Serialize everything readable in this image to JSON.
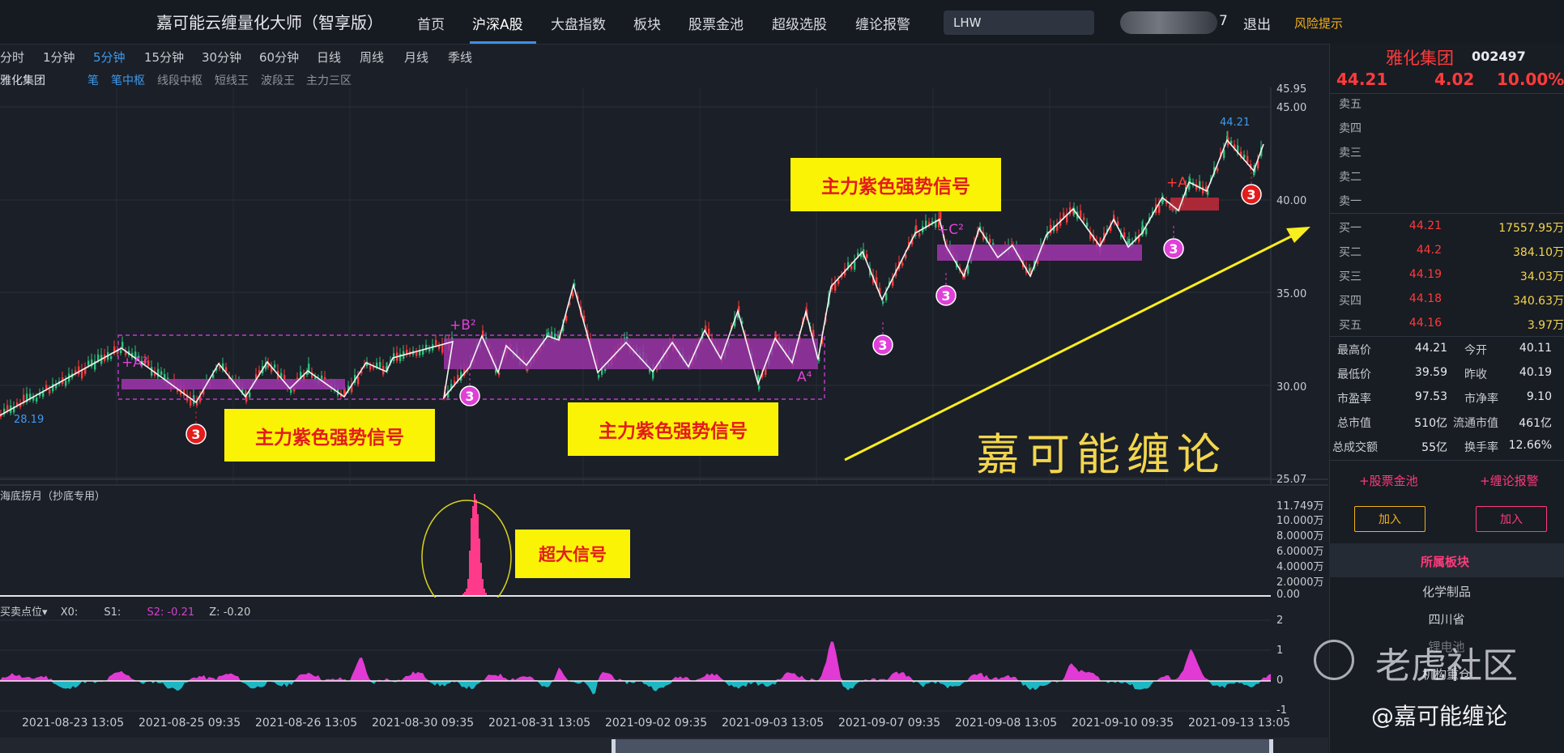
{
  "app": {
    "title": "嘉可能云缠量化大师（智享版）"
  },
  "nav": {
    "items": [
      "首页",
      "沪深A股",
      "大盘指数",
      "板块",
      "股票金池",
      "超级选股",
      "缠论报警"
    ],
    "active": "沪深A股"
  },
  "search": {
    "value": "LHW"
  },
  "user": {
    "suffix": "7",
    "logout": "退出",
    "risk": "风险提示"
  },
  "periods": {
    "items": [
      "分时",
      "1分钟",
      "5分钟",
      "15分钟",
      "30分钟",
      "60分钟",
      "日线",
      "周线",
      "月线",
      "季线"
    ],
    "active": "5分钟"
  },
  "indicator_bar": {
    "stock": "雅化集团",
    "items": [
      "笔",
      "笔中枢",
      "线段中枢",
      "短线王",
      "波段王",
      "主力三区"
    ],
    "active": [
      "笔",
      "笔中枢"
    ]
  },
  "price_axis": {
    "labels": [
      "45.95",
      "45.00",
      "40.00",
      "35.00",
      "30.00",
      "25.07"
    ]
  },
  "price_markers": {
    "last": "44.21",
    "low": "28.19"
  },
  "annotations": {
    "signal_text": "主力紫色强势信号",
    "big_signal": "超大信号",
    "brand": "嘉可能缠论",
    "labels": [
      "+A²",
      "+B²",
      "A⁴",
      "+C²",
      "+A"
    ],
    "badge": "3"
  },
  "sub_panel": {
    "title": "海底捞月（抄底专用）",
    "axis": [
      "11.749万",
      "10.000万",
      "8.0000万",
      "6.0000万",
      "4.0000万",
      "2.0000万",
      "0.00"
    ]
  },
  "osc_panel": {
    "name": "买卖点位",
    "x0": "X0:",
    "s1": "S1:",
    "s2_label": "S2:",
    "s2": "-0.21",
    "z_label": "Z:",
    "z": "-0.20",
    "axis": [
      "2",
      "1",
      "0",
      "-1"
    ]
  },
  "dates": [
    "2021-08-23 13:05",
    "2021-08-25 09:35",
    "2021-08-26 13:05",
    "2021-08-30 09:35",
    "2021-08-31 13:05",
    "2021-09-02 09:35",
    "2021-09-03 13:05",
    "2021-09-07 09:35",
    "2021-09-08 13:05",
    "2021-09-10 09:35",
    "2021-09-13 13:05"
  ],
  "stock": {
    "name": "雅化集团",
    "code": "002497",
    "price": "44.21",
    "change": "4.02",
    "pct": "10.00%"
  },
  "order_book": {
    "asks": [
      {
        "label": "卖五"
      },
      {
        "label": "卖四"
      },
      {
        "label": "卖三"
      },
      {
        "label": "卖二"
      },
      {
        "label": "卖一"
      }
    ],
    "bids": [
      {
        "label": "买一",
        "price": "44.21",
        "vol": "17557.95万"
      },
      {
        "label": "买二",
        "price": "44.2",
        "vol": "384.10万"
      },
      {
        "label": "买三",
        "price": "44.19",
        "vol": "34.03万"
      },
      {
        "label": "买四",
        "price": "44.18",
        "vol": "340.63万"
      },
      {
        "label": "买五",
        "price": "44.16",
        "vol": "3.97万"
      }
    ]
  },
  "stats": [
    {
      "l1": "最高价",
      "v1": "44.21",
      "l2": "今开",
      "v2": "40.11"
    },
    {
      "l1": "最低价",
      "v1": "39.59",
      "l2": "昨收",
      "v2": "40.19"
    },
    {
      "l1": "市盈率",
      "v1": "97.53",
      "l2": "市净率",
      "v2": "9.10"
    },
    {
      "l1": "总市值",
      "v1": "510亿",
      "l2": "流通市值",
      "v2": "461亿"
    },
    {
      "l1": "总成交额",
      "v1": "55亿",
      "l2": "换手率",
      "v2": "12.66%"
    }
  ],
  "actions": {
    "pool": "+股票金池",
    "alarm": "+缠论报警",
    "add1": "加入",
    "add2": "加入"
  },
  "sector": {
    "title": "所属板块",
    "items": [
      "化学制品",
      "四川省",
      "锂电池",
      "机构重仓"
    ]
  },
  "watermark": {
    "brand": "老虎社区",
    "handle": "@嘉可能缠论"
  },
  "colors": {
    "up": "#ff3b3b",
    "accent": "#3d9bf0",
    "zone": "#9b34a8",
    "signal_bg": "#fbf306",
    "badge": "#e040d8"
  }
}
